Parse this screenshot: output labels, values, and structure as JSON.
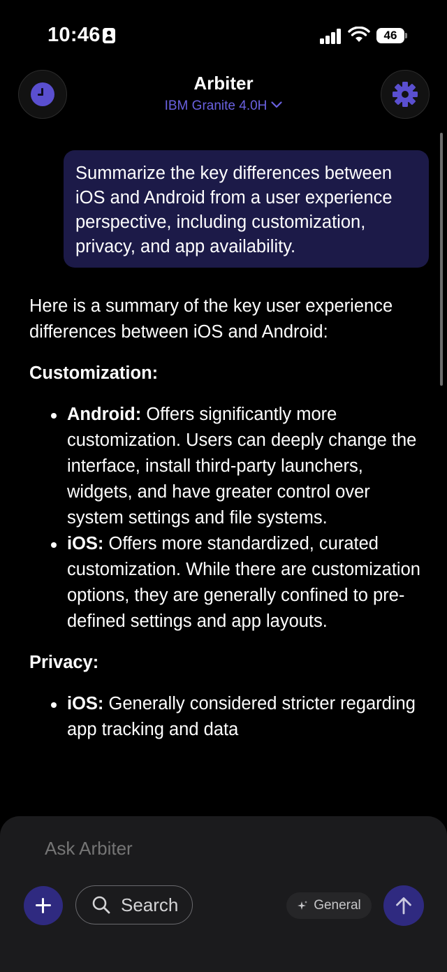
{
  "status_bar": {
    "time": "10:46",
    "battery": "46"
  },
  "header": {
    "title": "Arbiter",
    "model": "IBM Granite 4.0H"
  },
  "conversation": {
    "user_message": "Summarize the key differences between iOS and Android from a user experience perspective, including customization, privacy, and app availability.",
    "response": {
      "intro": "Here is a summary of the key user experience differences between iOS and Android:",
      "sections": [
        {
          "heading": "Customization:",
          "bullets": [
            {
              "label": "Android:",
              "text": " Offers significantly more customization. Users can deeply change the interface, install third-party launchers, widgets, and have greater control over system settings and file systems."
            },
            {
              "label": "iOS:",
              "text": " Offers more standardized, curated customization. While there are customization options, they are generally confined to pre-defined settings and app layouts."
            }
          ]
        },
        {
          "heading": "Privacy:",
          "bullets": [
            {
              "label": "iOS:",
              "text": " Generally considered stricter regarding app tracking and data"
            }
          ]
        }
      ]
    }
  },
  "composer": {
    "placeholder": "Ask Arbiter",
    "search_label": "Search",
    "mode_label": "General"
  },
  "colors": {
    "accent": "#5a4fcf",
    "bubble": "#1c1a48",
    "button": "#2f2a80",
    "background": "#000000"
  },
  "icons": [
    "id-card-icon",
    "signal-icon",
    "wifi-icon",
    "battery-icon",
    "history-icon",
    "gear-icon",
    "chevron-down-icon",
    "plus-icon",
    "search-icon",
    "sparkle-icon",
    "arrow-up-icon"
  ]
}
